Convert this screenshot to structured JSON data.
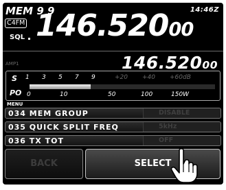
{
  "header": {
    "memory": "MEM 9 9",
    "clock": "14:46Z",
    "mode_badge": "C4FM",
    "sql_label": "SQL"
  },
  "main_freq": {
    "big": "146.520",
    "small": "00"
  },
  "sub_freq": {
    "big": "146.520",
    "small": "00"
  },
  "amp_label": "AMP1",
  "meter": {
    "s_label": "S",
    "po_label": "PO",
    "s_scale": [
      "1",
      "3",
      "5",
      "7",
      "9",
      "+20",
      "+40",
      "+60dB"
    ],
    "po_scale": [
      "0",
      "10",
      "50",
      "100",
      "150W"
    ],
    "level": 0.33
  },
  "menu": {
    "title": "MENU",
    "items": [
      {
        "label": "034 MEM GROUP",
        "value": "DISABLE"
      },
      {
        "label": "035 QUICK SPLIT FREQ",
        "value": "5kHz"
      },
      {
        "label": "036 TX TOT",
        "value": "OFF"
      }
    ]
  },
  "buttons": {
    "back": "BACK",
    "select": "SELECT"
  },
  "colors": {
    "background": "#000000",
    "text": "#ffffff",
    "disabled": "#3c3c3c"
  },
  "icons": {
    "pointer": "hand-pointer-icon"
  }
}
